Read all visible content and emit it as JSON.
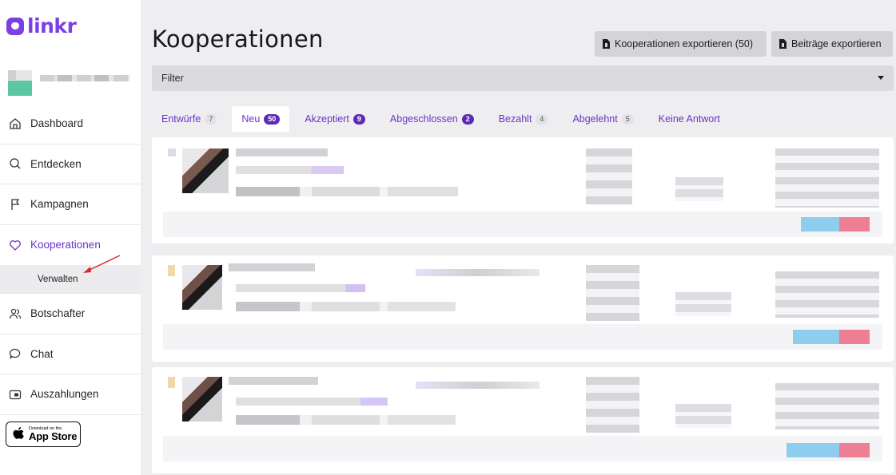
{
  "brand": {
    "logo_text": "linkr",
    "accent": "#7b3fe4",
    "tab_color": "#6a33c9"
  },
  "sidebar": {
    "items": [
      {
        "label": "Dashboard",
        "icon": "home-icon"
      },
      {
        "label": "Entdecken",
        "icon": "search-icon"
      },
      {
        "label": "Kampagnen",
        "icon": "flag-icon"
      },
      {
        "label": "Kooperationen",
        "icon": "heart-icon"
      },
      {
        "label": "Botschafter",
        "icon": "users-icon"
      },
      {
        "label": "Chat",
        "icon": "chat-icon"
      },
      {
        "label": "Auszahlungen",
        "icon": "wallet-icon"
      }
    ],
    "sub_item": "Verwalten",
    "appstore": {
      "small": "Download on the",
      "big": "App Store"
    }
  },
  "main": {
    "title": "Kooperationen",
    "export_coops": "Kooperationen exportieren (50)",
    "export_posts": "Beiträge exportieren",
    "filter_label": "Filter",
    "tabs": [
      {
        "label": "Entwürfe",
        "count": "7"
      },
      {
        "label": "Neu",
        "count": "50"
      },
      {
        "label": "Akzeptiert",
        "count": "9"
      },
      {
        "label": "Abgeschlossen",
        "count": "2"
      },
      {
        "label": "Bezahlt",
        "count": "4"
      },
      {
        "label": "Abgelehnt",
        "count": "5"
      },
      {
        "label": "Keine Antwort",
        "count": ""
      }
    ]
  }
}
